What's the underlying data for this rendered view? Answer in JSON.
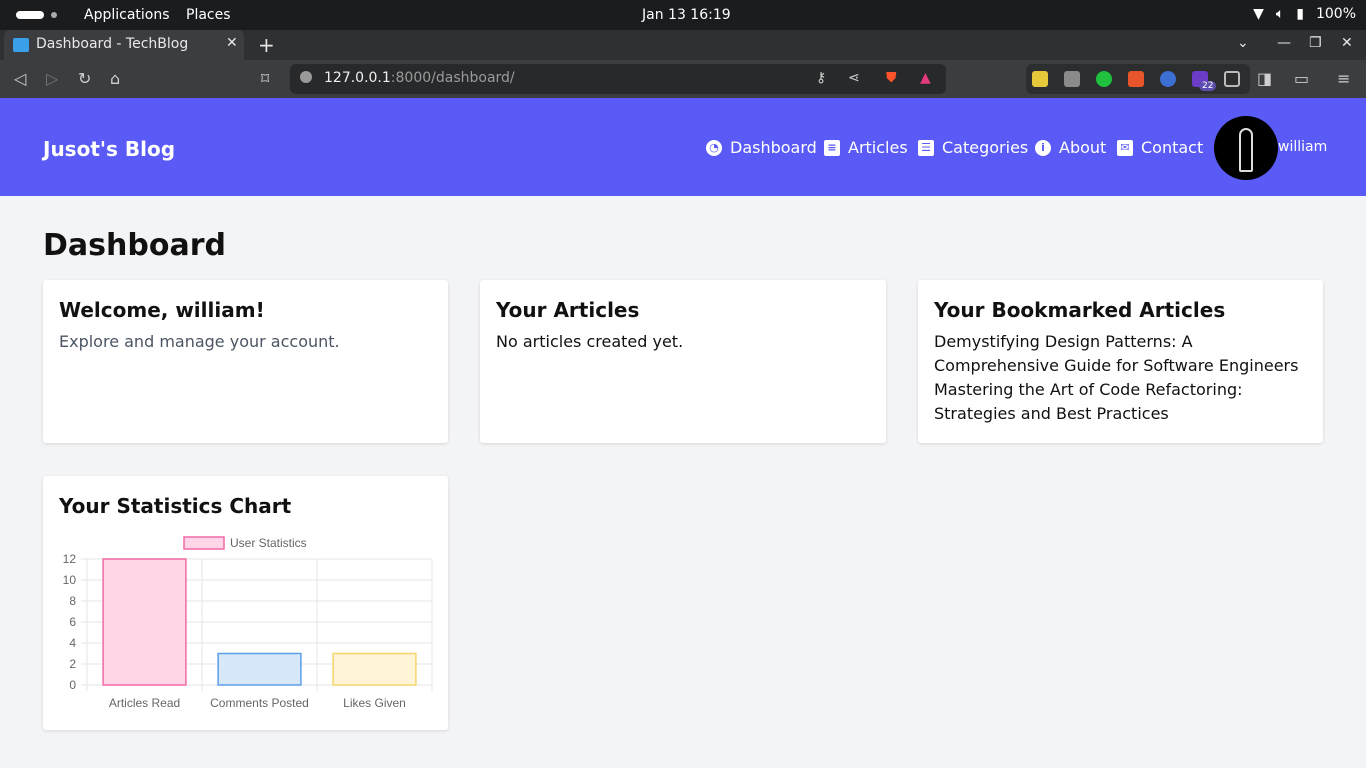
{
  "system_bar": {
    "menus": [
      "Applications",
      "Places"
    ],
    "clock": "Jan 13  16:19",
    "battery": "100%"
  },
  "browser": {
    "tab_title": "Dashboard - TechBlog",
    "url_host": "127.0.0.1",
    "url_path": ":8000/dashboard/",
    "extension_badge": "22"
  },
  "site": {
    "brand": "Jusot's Blog",
    "nav": [
      {
        "label": "Dashboard",
        "icon": "gauge-icon"
      },
      {
        "label": "Articles",
        "icon": "newspaper-icon"
      },
      {
        "label": "Categories",
        "icon": "list-icon"
      },
      {
        "label": "About",
        "icon": "info-icon"
      },
      {
        "label": "Contact",
        "icon": "envelope-icon"
      }
    ],
    "username": "william",
    "accent": "#5a5bf6"
  },
  "main": {
    "title": "Dashboard",
    "welcome": {
      "heading": "Welcome, william!",
      "text": "Explore and manage your account."
    },
    "articles": {
      "heading": "Your Articles",
      "text": "No articles created yet."
    },
    "bookmarks": {
      "heading": "Your Bookmarked Articles",
      "items": [
        "Demystifying Design Patterns: A Comprehensive Guide for Software Engineers",
        "Mastering the Art of Code Refactoring: Strategies and Best Practices"
      ]
    },
    "stats": {
      "heading": "Your Statistics Chart"
    }
  },
  "chart_data": {
    "type": "bar",
    "categories": [
      "Articles Read",
      "Comments Posted",
      "Likes Given"
    ],
    "series": [
      {
        "name": "User Statistics",
        "values": [
          12,
          3,
          3
        ]
      }
    ],
    "ylim": [
      0,
      12
    ],
    "yticks": [
      0,
      2,
      4,
      6,
      8,
      10,
      12
    ],
    "legend": "top",
    "grid": true,
    "colors": {
      "fill": [
        "#ffd6e7",
        "#d8e8fb",
        "#fff4d6"
      ],
      "stroke": [
        "#f06aa8",
        "#5f9ee8",
        "#f5d56b"
      ]
    }
  }
}
